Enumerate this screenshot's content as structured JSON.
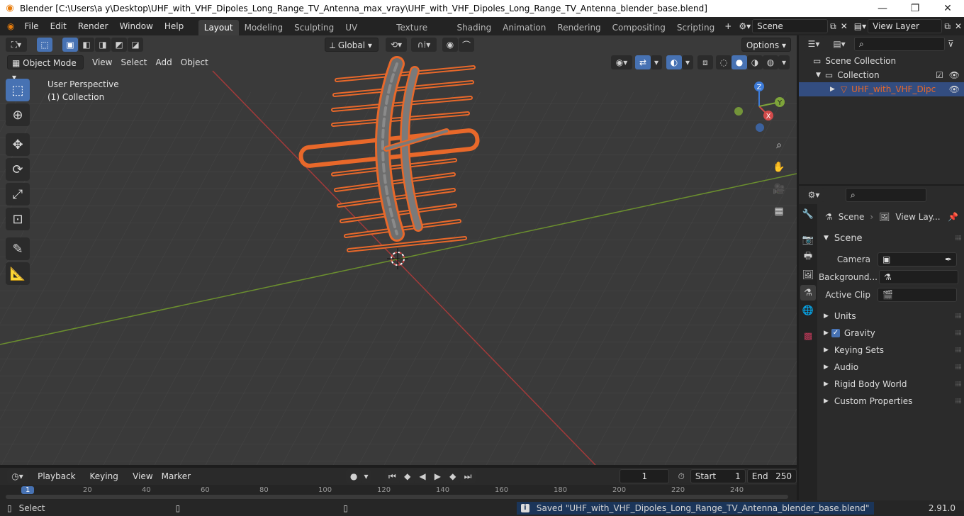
{
  "window": {
    "title": "Blender [C:\\Users\\a y\\Desktop\\UHF_with_VHF_Dipoles_Long_Range_TV_Antenna_max_vray\\UHF_with_VHF_Dipoles_Long_Range_TV_Antenna_blender_base.blend]",
    "minimize": "—",
    "maximize": "❐",
    "close": "✕"
  },
  "menu": [
    "File",
    "Edit",
    "Render",
    "Window",
    "Help"
  ],
  "workspaces": [
    "Layout",
    "Modeling",
    "Sculpting",
    "UV Editing",
    "Texture Paint",
    "Shading",
    "Animation",
    "Rendering",
    "Compositing",
    "Scripting"
  ],
  "active_workspace": "Layout",
  "scene_field": "Scene",
  "view_layer_field": "View Layer",
  "viewport": {
    "transform_orientation": "Global",
    "options_label": "Options",
    "mode": "Object Mode",
    "menus": [
      "View",
      "Select",
      "Add",
      "Object"
    ],
    "overlay_line1": "User Perspective",
    "overlay_line2": "(1) Collection",
    "axis_x": "X",
    "axis_y": "Y",
    "axis_z": "Z"
  },
  "outliner": {
    "scene_collection": "Scene Collection",
    "collection": "Collection",
    "object": "UHF_with_VHF_Dipc"
  },
  "properties": {
    "breadcrumb_scene": "Scene",
    "breadcrumb_view_layer": "View Lay...",
    "panel_scene": "Scene",
    "camera_label": "Camera",
    "background_label": "Background...",
    "active_clip_label": "Active Clip",
    "panels": [
      "Units",
      "Gravity",
      "Keying Sets",
      "Audio",
      "Rigid Body World",
      "Custom Properties"
    ]
  },
  "timeline": {
    "menus": [
      "Playback",
      "Keying",
      "View",
      "Marker"
    ],
    "current_frame": "1",
    "start_label": "Start",
    "start_value": "1",
    "end_label": "End",
    "end_value": "250",
    "ruler_ticks": [
      "1",
      "20",
      "40",
      "60",
      "80",
      "100",
      "120",
      "140",
      "160",
      "180",
      "200",
      "220",
      "240"
    ]
  },
  "status": {
    "left": "Select",
    "message": "Saved \"UHF_with_VHF_Dipoles_Long_Range_TV_Antenna_blender_base.blend\"",
    "version": "2.91.0"
  },
  "colors": {
    "selection_orange": "#e8682a",
    "active_blue": "#4772b3",
    "x_axis": "#d24a4a",
    "y_axis": "#7ea43a",
    "z_axis": "#3d7bd8"
  }
}
